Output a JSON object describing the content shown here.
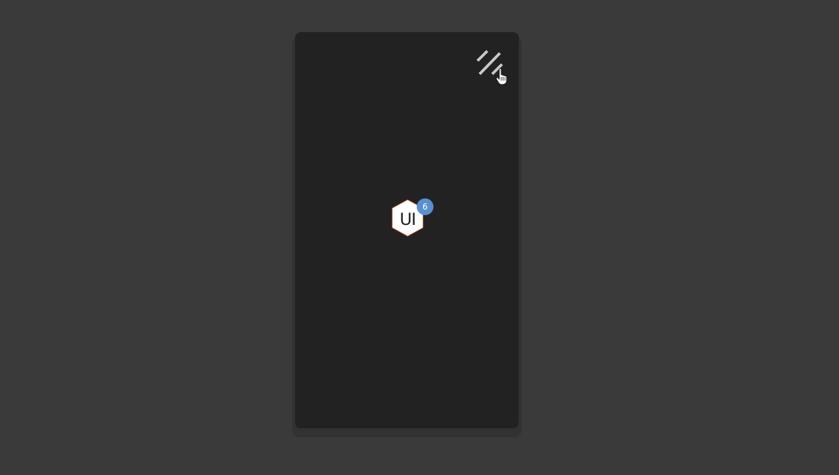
{
  "colors": {
    "page_background": "#3a3a3a",
    "panel_background": "#222222",
    "badge_background": "#5a8fd0",
    "logo_fill": "#ffffff",
    "toggle_stroke": "#c8c8c8"
  },
  "icons": {
    "menu_toggle": "menu-toggle-icon",
    "cursor": "hand-pointer-icon",
    "logo": "hexagon-logo-icon"
  },
  "logo": {
    "text": "UI",
    "badge_count": "6"
  }
}
